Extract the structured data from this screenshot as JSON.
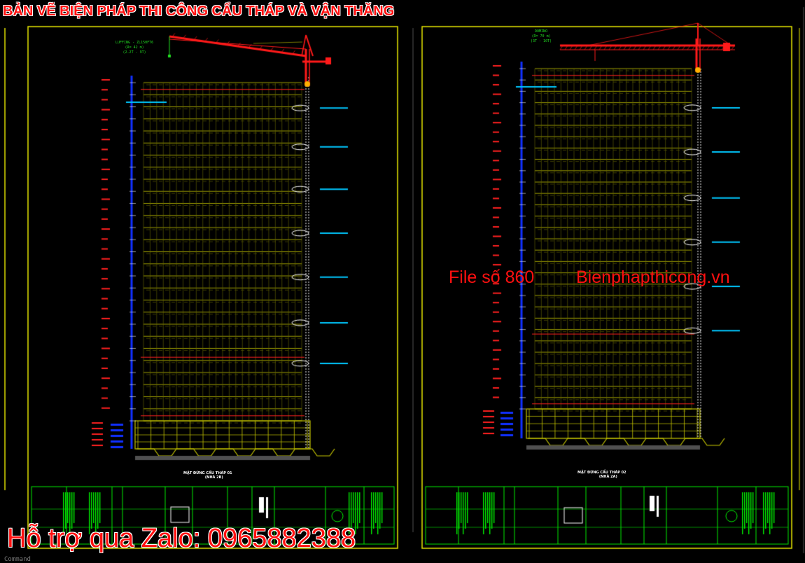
{
  "app": {
    "name": "CAD drawing viewer",
    "background": "#000000"
  },
  "overlay": {
    "title": "BẢN VẼ BIỆN PHÁP THI CÔNG CẨU THÁP VÀ VẬN THĂNG",
    "file_number": "File số 860",
    "website": "Bienphapthicong.vn",
    "support": "Hỗ trợ qua Zalo: 0965882388",
    "text_color": "#ff1010"
  },
  "command_line": {
    "label": "Command"
  },
  "sheets": [
    {
      "id": "sheet-1",
      "crane_label_line1": "LUFFING - ZL150FT6",
      "crane_label_line2": "(R= 42 m)",
      "crane_label_line3": "(2.2T - 9T)",
      "caption_line1": "MẶT ĐỨNG CẨU THÁP 01",
      "caption_line2": "(NHÀ 2B)",
      "floors": 28
    },
    {
      "id": "sheet-2",
      "crane_label_line1": "DOMINO",
      "crane_label_line2": "(R= 70 m)",
      "crane_label_line3": "(3T - 10T)",
      "caption_line1": "MẶT ĐỨNG CẨU THÁP 02",
      "caption_line2": "(NHÀ 2A)",
      "floors": 30
    }
  ],
  "colors": {
    "frame": "#e8e800",
    "title_block": "#00ee00",
    "building_yellow": "#c8c800",
    "grid_red": "#ff2020",
    "hoist_white": "#ffffff",
    "elevation_blue": "#1030ff",
    "cyan": "#00c8ff",
    "crane_red": "#ff1a1a"
  }
}
